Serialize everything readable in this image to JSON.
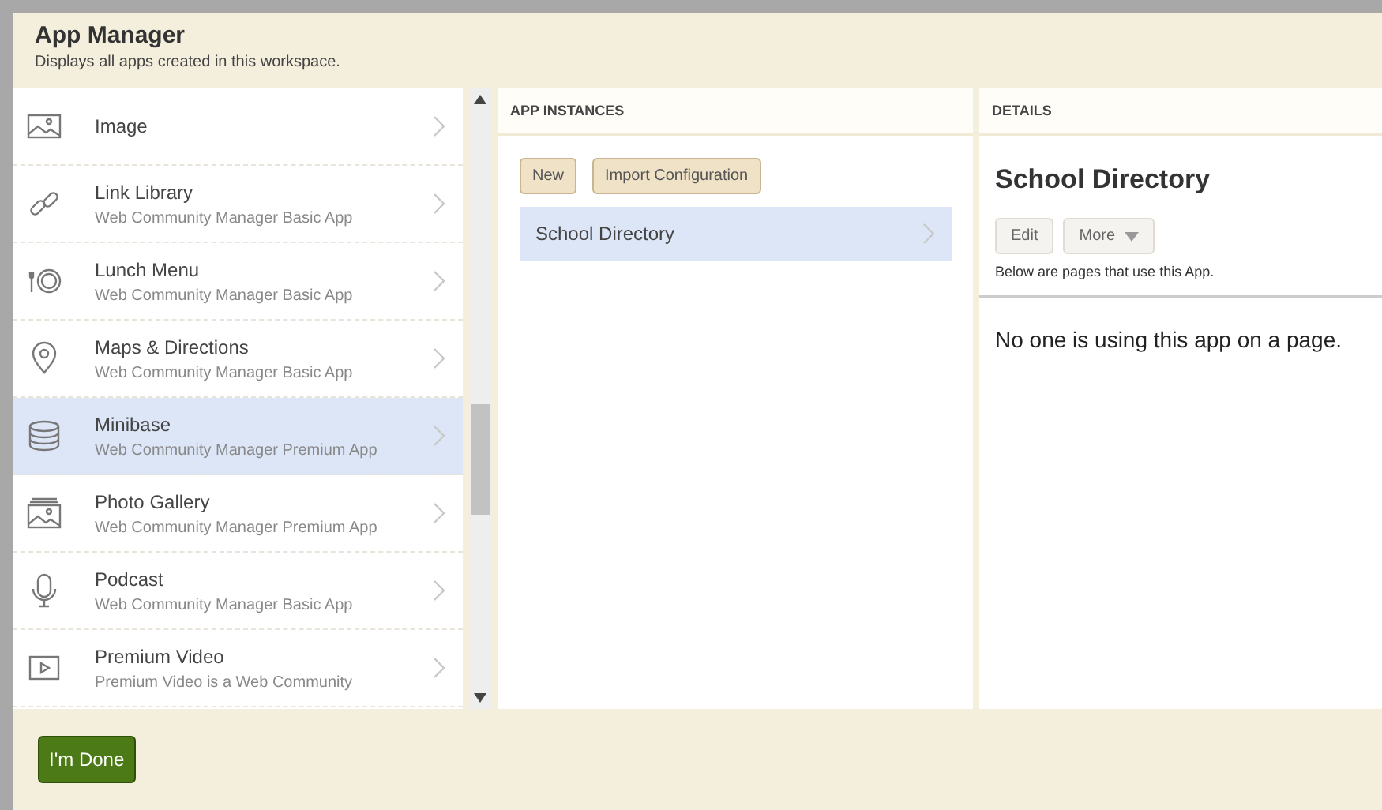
{
  "header": {
    "title": "App Manager",
    "subtitle": "Displays all apps created in this workspace."
  },
  "apps": [
    {
      "kind": "image",
      "name": "Image",
      "selected": false
    },
    {
      "kind": "link",
      "name": "Link Library",
      "subtitle": "Web Community Manager Basic App",
      "selected": false
    },
    {
      "kind": "lunch",
      "name": "Lunch Menu",
      "subtitle": "Web Community Manager Basic App",
      "selected": false
    },
    {
      "kind": "map",
      "name": "Maps & Directions",
      "subtitle": "Web Community Manager Basic App",
      "selected": false
    },
    {
      "kind": "database",
      "name": "Minibase",
      "subtitle": "Web Community Manager Premium App",
      "selected": true
    },
    {
      "kind": "gallery",
      "name": "Photo Gallery",
      "subtitle": "Web Community Manager Premium App",
      "selected": false
    },
    {
      "kind": "podcast",
      "name": "Podcast",
      "subtitle": "Web Community Manager Basic App",
      "selected": false
    },
    {
      "kind": "video",
      "name": "Premium Video",
      "subtitle": "Premium Video is a Web Community",
      "selected": false
    }
  ],
  "instances": {
    "heading": "APP INSTANCES",
    "buttons": [
      "New",
      "Import Configuration"
    ],
    "items": [
      {
        "name": "School Directory",
        "selected": true
      }
    ]
  },
  "details": {
    "heading": "DETAILS",
    "title": "School Directory",
    "buttons": [
      "Edit",
      "More"
    ],
    "note": "Below are pages that use this App.",
    "empty": "No one is using this app on a page."
  },
  "footer": {
    "button": "I'm Done"
  }
}
